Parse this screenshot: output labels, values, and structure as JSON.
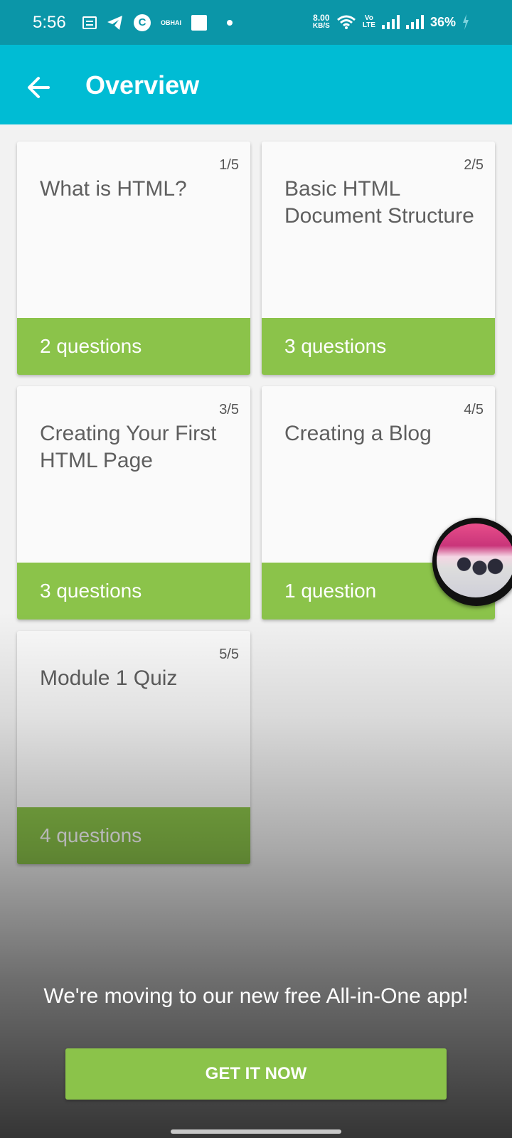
{
  "status_bar": {
    "time": "5:56",
    "icons_left": [
      "message-icon",
      "telegram-icon",
      "c-app-icon",
      "obhai-icon",
      "square-app-icon",
      "dot-icon"
    ],
    "tiny_label": "OBHAI",
    "net_speed_value": "8.00",
    "net_speed_unit": "KB/S",
    "volte_top": "Vo",
    "volte_bottom": "LTE",
    "battery": "36%"
  },
  "app_bar": {
    "title": "Overview"
  },
  "cards": [
    {
      "counter": "1/5",
      "title": "What is HTML?",
      "footer": "2 questions"
    },
    {
      "counter": "2/5",
      "title": "Basic HTML Document Structure",
      "footer": "3 questions"
    },
    {
      "counter": "3/5",
      "title": "Creating Your First HTML Page",
      "footer": "3 questions"
    },
    {
      "counter": "4/5",
      "title": "Creating a Blog",
      "footer": "1 question"
    },
    {
      "counter": "5/5",
      "title": "Module 1 Quiz",
      "footer": "4 questions"
    }
  ],
  "promo": {
    "text": "We're moving to our new free All-in-One app!",
    "button_label": "GET IT NOW"
  },
  "colors": {
    "status_bar": "#0b96a8",
    "app_bar": "#00bcd4",
    "accent_green": "#8bc34a"
  }
}
